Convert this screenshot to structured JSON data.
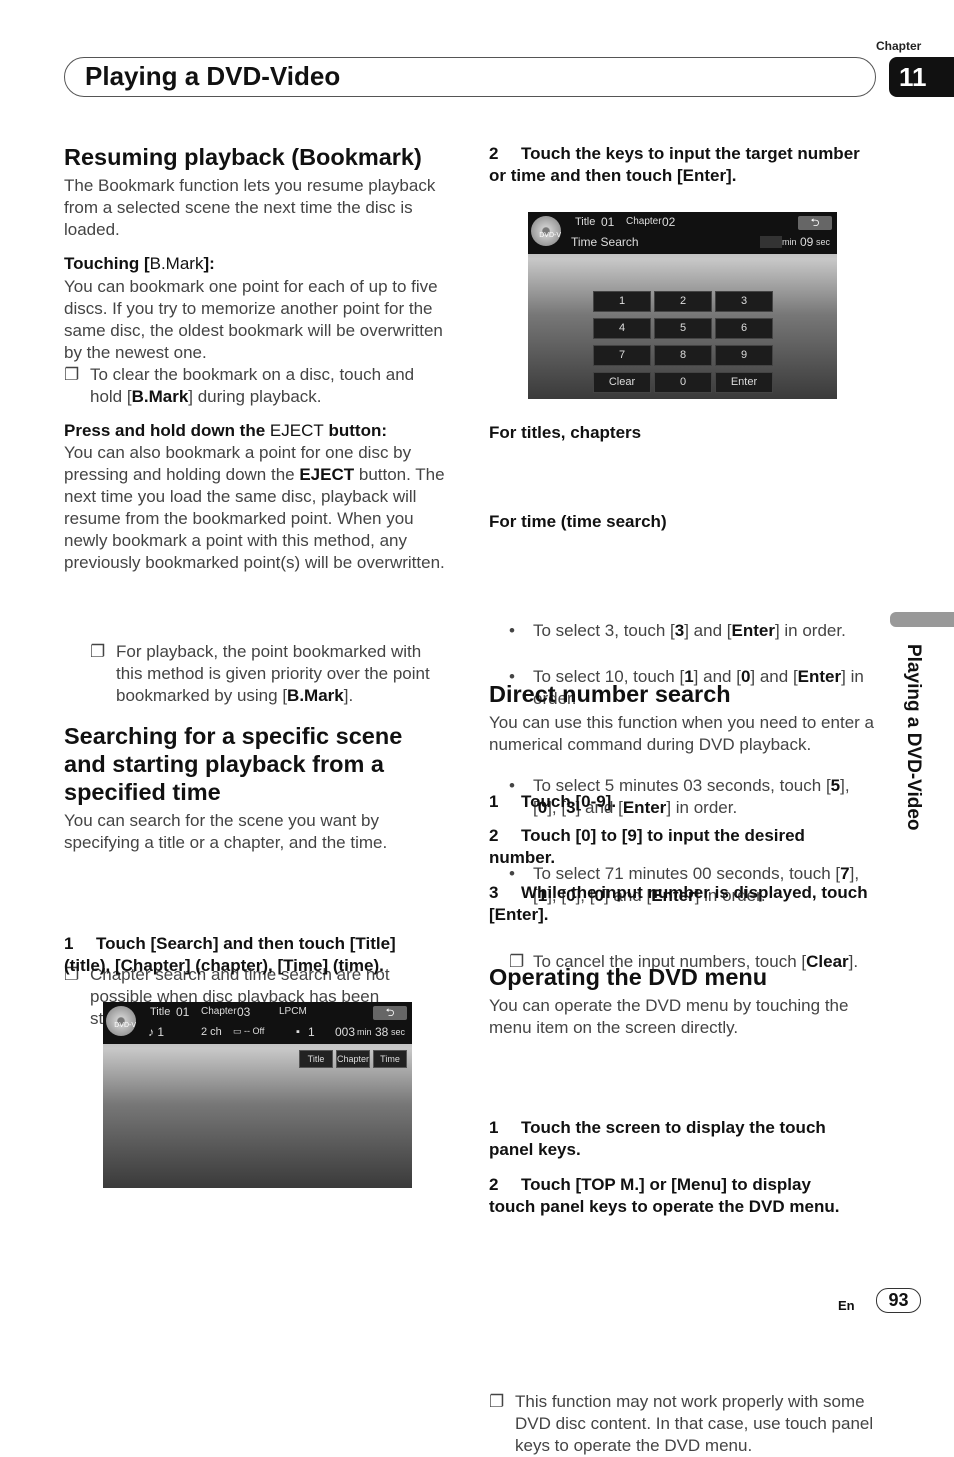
{
  "header": {
    "title": "Playing a DVD-Video",
    "chapter_label": "Chapter",
    "chapter_number": "11"
  },
  "side_tab": "Playing a DVD-Video",
  "footer": {
    "lang": "En",
    "page": "93"
  },
  "bookmark": {
    "heading": "Resuming playback (Bookmark)",
    "intro": "The Bookmark function lets you resume playback from a selected scene the next time the disc is loaded.",
    "touching_heading": [
      [
        "Touching [",
        1
      ],
      [
        "B.Mark",
        0
      ],
      [
        "]:",
        1
      ]
    ],
    "touching_text": "You can bookmark one point for each of up to five discs. If you try to memorize another point for the same disc, the oldest bookmark will be overwritten by the newest one.",
    "touching_note": [
      [
        "To clear the bookmark on a disc, touch and hold [",
        0
      ],
      [
        "B.Mark",
        1
      ],
      [
        "] during playback.",
        0
      ]
    ],
    "eject_heading": [
      [
        "Press and hold down the ",
        1
      ],
      [
        "EJECT",
        0
      ],
      [
        " button:",
        1
      ]
    ],
    "eject_text": [
      [
        "You can also bookmark a point for one disc by pressing and holding down the ",
        0
      ],
      [
        "EJECT",
        1
      ],
      [
        " button. The next time you load the same disc, playback will resume from the bookmarked point. When you newly bookmark a point with this method, any previously bookmarked point(s) will be overwritten.",
        0
      ]
    ],
    "eject_note": [
      [
        "For playback, the point bookmarked with this method is given priority over the point bookmarked by using [",
        0
      ],
      [
        "B.Mark",
        1
      ],
      [
        "].",
        0
      ]
    ],
    "note_marker": "❐"
  },
  "search": {
    "heading": "Searching for a specific scene and starting playback from a specified time",
    "intro": "You can search for the scene you want by specifying a title or a chapter, and the time.",
    "note": "Chapter search and time search are not possible when disc playback has been stopped.",
    "step1_num": "1",
    "step1": "Touch [Search] and then touch [Title] (title), [Chapter] (chapter), [Time] (time).",
    "step2_num": "2",
    "step2": "Touch the keys to input the target number or time and then touch [Enter].",
    "titles_heading": "For titles, chapters",
    "titles_items": [
      [
        [
          "To select 3, touch [",
          0
        ],
        [
          "3",
          1
        ],
        [
          "] and [",
          0
        ],
        [
          "Enter",
          1
        ],
        [
          "] in order.",
          0
        ]
      ],
      [
        [
          "To select 10, touch [",
          0
        ],
        [
          "1",
          1
        ],
        [
          "] and [",
          0
        ],
        [
          "0",
          1
        ],
        [
          "] and [",
          0
        ],
        [
          "Enter",
          1
        ],
        [
          "] in order.",
          0
        ]
      ]
    ],
    "time_heading": "For time (time search)",
    "time_items": [
      [
        [
          "To select 5 minutes 03 seconds, touch [",
          0
        ],
        [
          "5",
          1
        ],
        [
          "], [",
          0
        ],
        [
          "0",
          1
        ],
        [
          "], [",
          0
        ],
        [
          "3",
          1
        ],
        [
          "] and [",
          0
        ],
        [
          "Enter",
          1
        ],
        [
          "] in order.",
          0
        ]
      ],
      [
        [
          "To select 71 minutes 00 seconds, touch [",
          0
        ],
        [
          "7",
          1
        ],
        [
          "], [",
          0
        ],
        [
          "1",
          1
        ],
        [
          "], [",
          0
        ],
        [
          "0",
          1
        ],
        [
          "], [",
          0
        ],
        [
          "0",
          1
        ],
        [
          "] and [",
          0
        ],
        [
          "Enter",
          1
        ],
        [
          "] in order.",
          0
        ]
      ]
    ],
    "cancel_note": [
      [
        "To cancel the input numbers, touch [",
        0
      ],
      [
        "Clear",
        1
      ],
      [
        "].",
        0
      ]
    ],
    "bullet": "•"
  },
  "screen1": {
    "disc": "DVD-V",
    "title_label": "Title",
    "title_num": "01",
    "chapter_label": "Chapter",
    "chapter_num": "03",
    "audio": "LPCM",
    "audio_track": "♪ 1",
    "channels": "2 ch",
    "subtitle": "▭ ‐‐  Off",
    "angle": "1",
    "time_min": "003",
    "min": "min",
    "time_sec": "38",
    "sec": "sec",
    "back": "⮌",
    "buttons": [
      "Title",
      "Chapter",
      "Time"
    ]
  },
  "screen2": {
    "disc": "DVD-V",
    "title_label": "Title",
    "title_num": "01",
    "chapter_label": "Chapter",
    "chapter_num": "02",
    "mode": "Time Search",
    "min": "min",
    "time_sec": "09",
    "sec": "sec",
    "back": "⮌",
    "keys": [
      "1",
      "2",
      "3",
      "4",
      "5",
      "6",
      "7",
      "8",
      "9",
      "Clear",
      "0",
      "Enter"
    ]
  },
  "direct": {
    "heading": "Direct number search",
    "intro": "You can use this function when you need to enter a numerical command during DVD playback.",
    "steps": [
      {
        "n": "1",
        "t": "Touch [0-9]."
      },
      {
        "n": "2",
        "t": "Touch [0] to [9] to input the desired number."
      },
      {
        "n": "3",
        "t": "While the input number is displayed, touch [Enter]."
      }
    ]
  },
  "menu": {
    "heading": "Operating the DVD menu",
    "intro": "You can operate the DVD menu by touching the menu item on the screen directly.",
    "note": "This function may not work properly with some DVD disc content. In that case, use touch panel keys to operate the DVD menu.",
    "steps": [
      {
        "n": "1",
        "t": "Touch the screen to display the touch panel keys."
      },
      {
        "n": "2",
        "t": "Touch [TOP M.] or [Menu] to display touch panel keys to operate the DVD menu."
      }
    ]
  }
}
